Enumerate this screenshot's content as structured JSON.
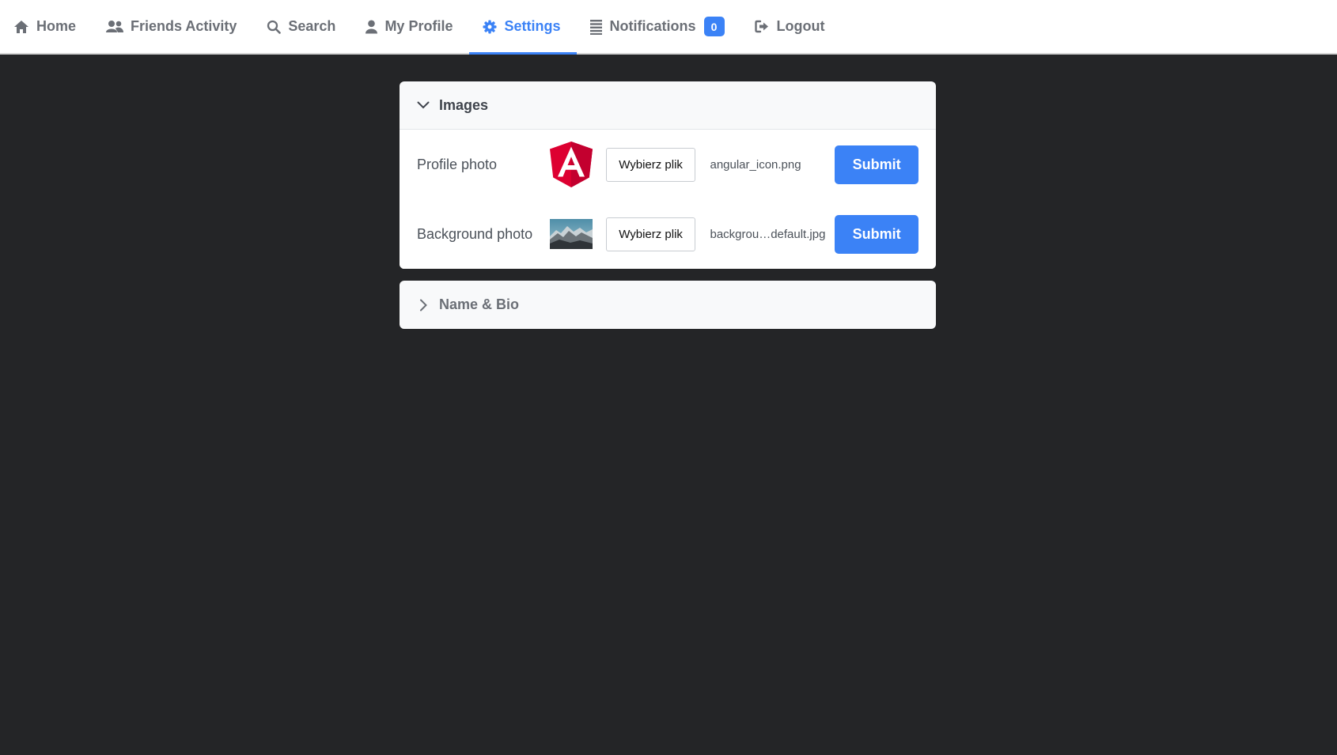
{
  "nav": {
    "items": [
      {
        "label": "Home",
        "icon": "home-icon"
      },
      {
        "label": "Friends Activity",
        "icon": "users-icon"
      },
      {
        "label": "Search",
        "icon": "search-icon"
      },
      {
        "label": "My Profile",
        "icon": "user-icon"
      },
      {
        "label": "Settings",
        "icon": "gear-icon",
        "active": true
      },
      {
        "label": "Notifications",
        "icon": "list-icon",
        "badge": "0"
      },
      {
        "label": "Logout",
        "icon": "logout-icon"
      }
    ]
  },
  "images_section": {
    "title": "Images",
    "expanded": true,
    "rows": [
      {
        "label": "Profile photo",
        "button": "Wybierz plik",
        "file": "angular_icon.png",
        "submit": "Submit",
        "thumbnail": "angular-logo-icon"
      },
      {
        "label": "Background photo",
        "button": "Wybierz plik",
        "file": "backgrou…default.jpg",
        "submit": "Submit",
        "thumbnail": "mountain-landscape-image"
      }
    ]
  },
  "name_section": {
    "title": "Name & Bio",
    "expanded": false
  },
  "colors": {
    "accent": "#3b82f6",
    "background": "#242527",
    "angular_red": "#dd0031"
  }
}
